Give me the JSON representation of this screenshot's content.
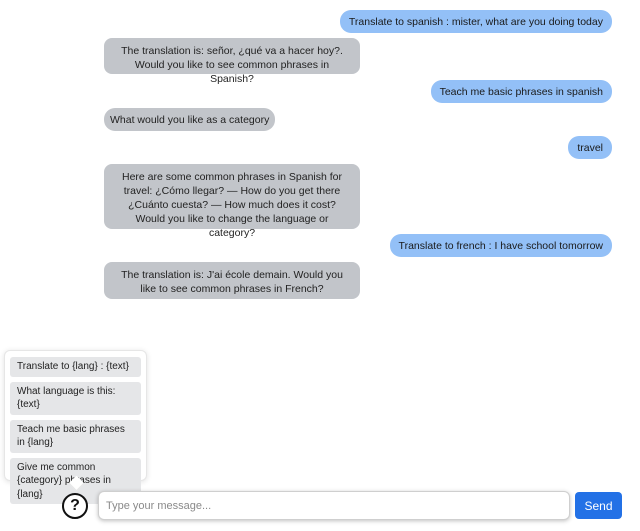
{
  "messages": [
    {
      "role": "user",
      "text": "Translate to spanish : mister, what are you doing today"
    },
    {
      "role": "bot",
      "text": "The translation is: señor, ¿qué va a hacer hoy?. Would you like to see common phrases in Spanish?"
    },
    {
      "role": "user",
      "text": "Teach me basic phrases in spanish"
    },
    {
      "role": "bot",
      "text": "What would you like as a category"
    },
    {
      "role": "user",
      "text": "travel"
    },
    {
      "role": "bot",
      "text": "Here are some common phrases in Spanish for travel: ¿Cómo llegar? — How do you get there ¿Cuánto cuesta? — How much does it cost? Would you like to change the language or category?"
    },
    {
      "role": "user",
      "text": "Translate to french : I have school tomorrow"
    },
    {
      "role": "bot",
      "text": "The translation is: J'ai école demain. Would you like to see common phrases in French?"
    }
  ],
  "suggestions": [
    "Translate to {lang} : {text}",
    "What language is this: {text}",
    "Teach me basic phrases in {lang}",
    "Give me common {category} phrases in {lang}"
  ],
  "help_icon": "question-circle-icon",
  "help_glyph": "?",
  "input": {
    "value": "",
    "placeholder": "Type your message..."
  },
  "send_label": "Send",
  "colors": {
    "user_bubble": "#93c0f7",
    "bot_bubble": "#c2c5ca",
    "send_button": "#2371e6"
  }
}
